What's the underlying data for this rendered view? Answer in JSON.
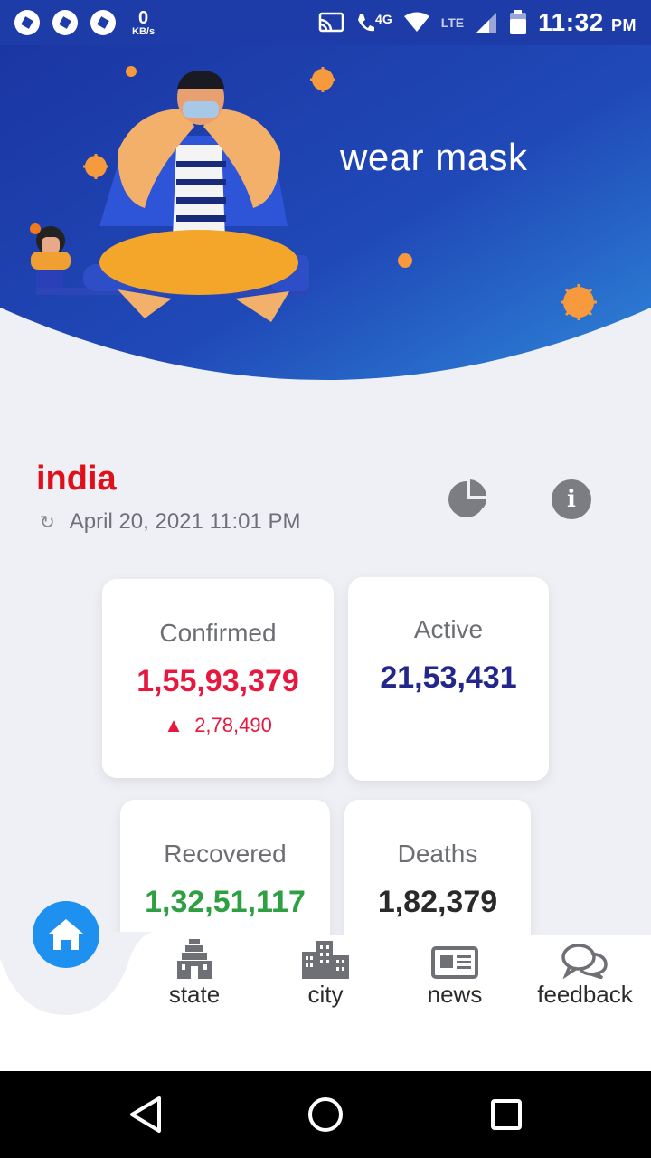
{
  "status_bar": {
    "net_speed_value": "0",
    "net_speed_unit": "KB/s",
    "network_4g": "4G",
    "network_lte": "LTE",
    "time": "11:32",
    "ampm": "PM"
  },
  "hero": {
    "title": "wear mask"
  },
  "location": {
    "name": "india",
    "updated": "April 20, 2021 11:01 PM"
  },
  "stats": {
    "confirmed": {
      "label": "Confirmed",
      "value": "1,55,93,379",
      "delta": "2,78,490",
      "color": "#e8173e"
    },
    "active": {
      "label": "Active",
      "value": "21,53,431",
      "color": "#23268a"
    },
    "recovered": {
      "label": "Recovered",
      "value": "1,32,51,117",
      "color": "#2ea043"
    },
    "deaths": {
      "label": "Deaths",
      "value": "1,82,379",
      "color": "#2a2a2a"
    }
  },
  "nav": {
    "items": [
      {
        "id": "home",
        "label": ""
      },
      {
        "id": "state",
        "label": "state"
      },
      {
        "id": "city",
        "label": "city"
      },
      {
        "id": "news",
        "label": "news"
      },
      {
        "id": "feedback",
        "label": "feedback"
      }
    ]
  },
  "colors": {
    "brand_blue": "#1e3ca8",
    "home_accent": "#1e90f0",
    "location_red": "#e0101a"
  }
}
